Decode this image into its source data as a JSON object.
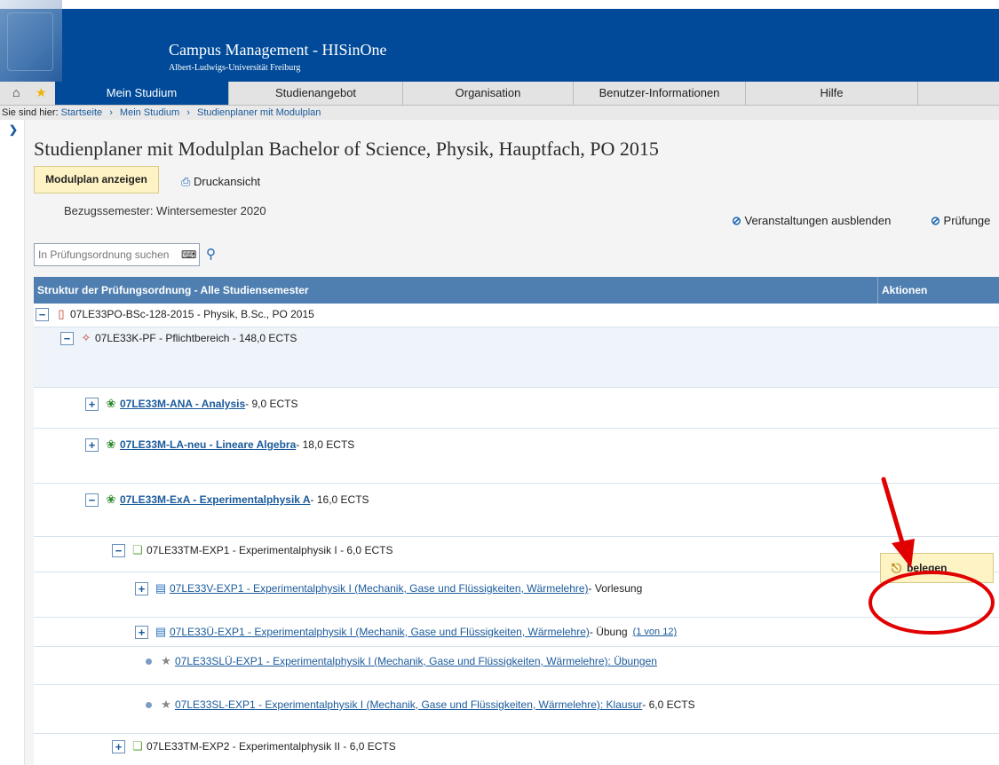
{
  "header": {
    "title": "Campus Management - HISinOne",
    "subtitle": "Albert-Ludwigs-Universität Freiburg"
  },
  "nav": {
    "items": [
      {
        "label": "Mein Studium",
        "active": true
      },
      {
        "label": "Studienangebot",
        "active": false
      },
      {
        "label": "Organisation",
        "active": false
      },
      {
        "label": "Benutzer-Informationen",
        "active": false
      },
      {
        "label": "Hilfe",
        "active": false
      }
    ]
  },
  "breadcrumb": {
    "prefix": "Sie sind hier:",
    "items": [
      "Startseite",
      "Mein Studium",
      "Studienplaner mit Modulplan"
    ]
  },
  "page": {
    "title": "Studienplaner mit Modulplan Bachelor of Science, Physik, Hauptfach, PO 2015",
    "modulplan_button": "Modulplan anzeigen",
    "print_link": "Druckansicht",
    "semester": "Bezugssemester: Wintersemester 2020",
    "toggle_events": "Veranstaltungen ausblenden",
    "toggle_exams": "Prüfunge"
  },
  "search": {
    "placeholder": "In Prüfungsordnung suchen"
  },
  "table": {
    "header_structure": "Struktur der Prüfungsordnung - Alle Studiensemester",
    "header_actions": "Aktionen",
    "rows": [
      {
        "toggle": "−",
        "icon": "document-red-icon",
        "link": "",
        "text": "07LE33PO-BSc-128-2015 - Physik, B.Sc., PO 2015"
      },
      {
        "toggle": "−",
        "icon": "tag-icon",
        "link": "",
        "text": "07LE33K-PF - Pflichtbereich - 148,0 ECTS"
      },
      {
        "toggle": "+",
        "icon": "puzzle-icon",
        "link": "07LE33M-ANA - Analysis",
        "text": " - 9,0 ECTS"
      },
      {
        "toggle": "+",
        "icon": "puzzle-icon",
        "link": "07LE33M-LA-neu - Lineare Algebra",
        "text": " - 18,0 ECTS"
      },
      {
        "toggle": "−",
        "icon": "puzzle-icon",
        "link": "07LE33M-ExA - Experimentalphysik A",
        "text": " - 16,0 ECTS"
      },
      {
        "toggle": "−",
        "icon": "cubes-icon",
        "link": "",
        "text": "07LE33TM-EXP1 - Experimentalphysik I - 6,0 ECTS"
      },
      {
        "toggle": "+",
        "icon": "book-icon",
        "link": "07LE33V-EXP1 - Experimentalphysik I (Mechanik, Gase und Flüssigkeiten, Wärmelehre)",
        "text": " - Vorlesung"
      },
      {
        "toggle": "+",
        "icon": "book-icon",
        "link": "07LE33Ü-EXP1 - Experimentalphysik I (Mechanik, Gase und Flüssigkeiten, Wärmelehre)",
        "text": " - Übung",
        "extra": "(1 von 12)"
      },
      {
        "toggle": "",
        "icon": "award-icon",
        "link": "07LE33SLÜ-EXP1 - Experimentalphysik I (Mechanik, Gase und Flüssigkeiten, Wärmelehre): Übungen",
        "text": ""
      },
      {
        "toggle": "",
        "icon": "award-icon",
        "link": "07LE33SL-EXP1 - Experimentalphysik I (Mechanik, Gase und Flüssigkeiten, Wärmelehre): Klausur",
        "text": " - 6,0 ECTS"
      },
      {
        "toggle": "+",
        "icon": "cubes-icon",
        "link": "",
        "text": "07LE33TM-EXP2 - Experimentalphysik II - 6,0 ECTS"
      }
    ]
  },
  "actions": {
    "belegen": "belegen"
  },
  "colors": {
    "header_blue": "#004a99",
    "table_header": "#4f7fb0",
    "button_yellow": "#fdf3c4",
    "annotation_red": "#e00000"
  }
}
